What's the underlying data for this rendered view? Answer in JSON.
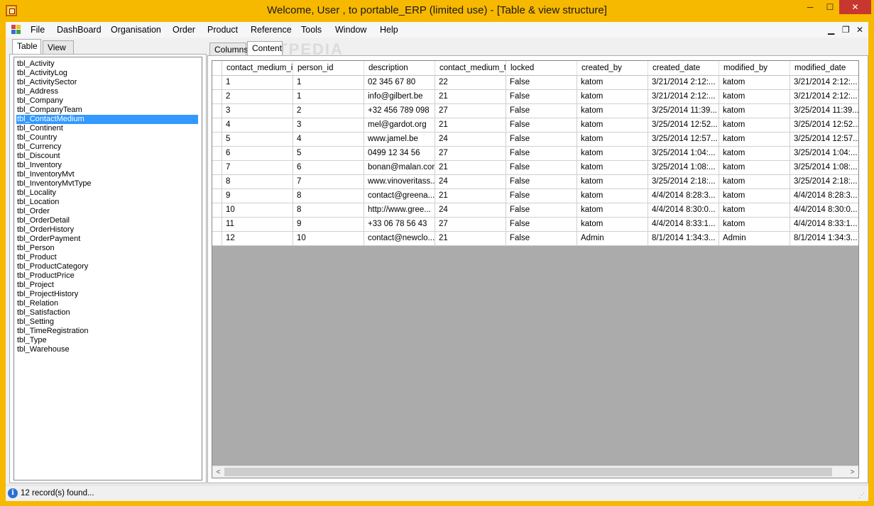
{
  "window": {
    "title": "Welcome, User , to portable_ERP (limited use) - [Table & view structure]",
    "min_glyph": "─",
    "max_glyph": "☐",
    "close_glyph": "✕"
  },
  "menu": {
    "items": [
      "File",
      "DashBoard",
      "Organisation",
      "Order",
      "Product",
      "Reference",
      "Tools",
      "Window",
      "Help"
    ],
    "mdi_min": "▁",
    "mdi_restore": "❐",
    "mdi_close": "✕"
  },
  "left_tabs": [
    "Table",
    "View"
  ],
  "tables": [
    "tbl_Activity",
    "tbl_ActivityLog",
    "tbl_ActivitySector",
    "tbl_Address",
    "tbl_Company",
    "tbl_CompanyTeam",
    "tbl_ContactMedium",
    "tbl_Continent",
    "tbl_Country",
    "tbl_Currency",
    "tbl_Discount",
    "tbl_Inventory",
    "tbl_InventoryMvt",
    "tbl_InventoryMvtType",
    "tbl_Locality",
    "tbl_Location",
    "tbl_Order",
    "tbl_OrderDetail",
    "tbl_OrderHistory",
    "tbl_OrderPayment",
    "tbl_Person",
    "tbl_Product",
    "tbl_ProductCategory",
    "tbl_ProductPrice",
    "tbl_Project",
    "tbl_ProjectHistory",
    "tbl_Relation",
    "tbl_Satisfaction",
    "tbl_Setting",
    "tbl_TimeRegistration",
    "tbl_Type",
    "tbl_Warehouse"
  ],
  "selected_table": "tbl_ContactMedium",
  "right_tabs": [
    "Columns",
    "Content"
  ],
  "watermark": "SOFTPEDIA",
  "grid": {
    "columns": [
      "contact_medium_id",
      "person_id",
      "description",
      "contact_medium_ty",
      "locked",
      "created_by",
      "created_date",
      "modified_by",
      "modified_date"
    ],
    "rows": [
      [
        "1",
        "1",
        "02 345 67 80",
        "22",
        "False",
        "katom",
        "3/21/2014 2:12:...",
        "katom",
        "3/21/2014 2:12:..."
      ],
      [
        "2",
        "1",
        "info@gilbert.be",
        "21",
        "False",
        "katom",
        "3/21/2014 2:12:...",
        "katom",
        "3/21/2014 2:12:..."
      ],
      [
        "3",
        "2",
        "+32 456 789 098",
        "27",
        "False",
        "katom",
        "3/25/2014 11:39...",
        "katom",
        "3/25/2014 11:39..."
      ],
      [
        "4",
        "3",
        "mel@gardot.org",
        "21",
        "False",
        "katom",
        "3/25/2014 12:52...",
        "katom",
        "3/25/2014 12:52..."
      ],
      [
        "5",
        "4",
        "www.jamel.be",
        "24",
        "False",
        "katom",
        "3/25/2014 12:57...",
        "katom",
        "3/25/2014 12:57..."
      ],
      [
        "6",
        "5",
        "0499 12 34 56",
        "27",
        "False",
        "katom",
        "3/25/2014 1:04:...",
        "katom",
        "3/25/2014 1:04:..."
      ],
      [
        "7",
        "6",
        "bonan@malan.com",
        "21",
        "False",
        "katom",
        "3/25/2014 1:08:...",
        "katom",
        "3/25/2014 1:08:..."
      ],
      [
        "8",
        "7",
        "www.vinoveritass...",
        "24",
        "False",
        "katom",
        "3/25/2014 2:18:...",
        "katom",
        "3/25/2014 2:18:..."
      ],
      [
        "9",
        "8",
        "contact@greena...",
        "21",
        "False",
        "katom",
        "4/4/2014 8:28:3...",
        "katom",
        "4/4/2014 8:28:3..."
      ],
      [
        "10",
        "8",
        "http://www.gree...",
        "24",
        "False",
        "katom",
        "4/4/2014 8:30:0...",
        "katom",
        "4/4/2014 8:30:0..."
      ],
      [
        "11",
        "9",
        "+33 06 78 56 43",
        "27",
        "False",
        "katom",
        "4/4/2014 8:33:1...",
        "katom",
        "4/4/2014 8:33:1..."
      ],
      [
        "12",
        "10",
        "contact@newclo...",
        "21",
        "False",
        "Admin",
        "8/1/2014 1:34:3...",
        "Admin",
        "8/1/2014 1:34:3..."
      ]
    ]
  },
  "scroll": {
    "left_arrow": "<",
    "right_arrow": ">"
  },
  "status": {
    "icon_glyph": "i",
    "text": "12 record(s) found..."
  },
  "colors": {
    "frame": "#f7b800",
    "selection": "#3399ff",
    "close_button": "#c7372f",
    "grid_empty": "#ababab"
  }
}
